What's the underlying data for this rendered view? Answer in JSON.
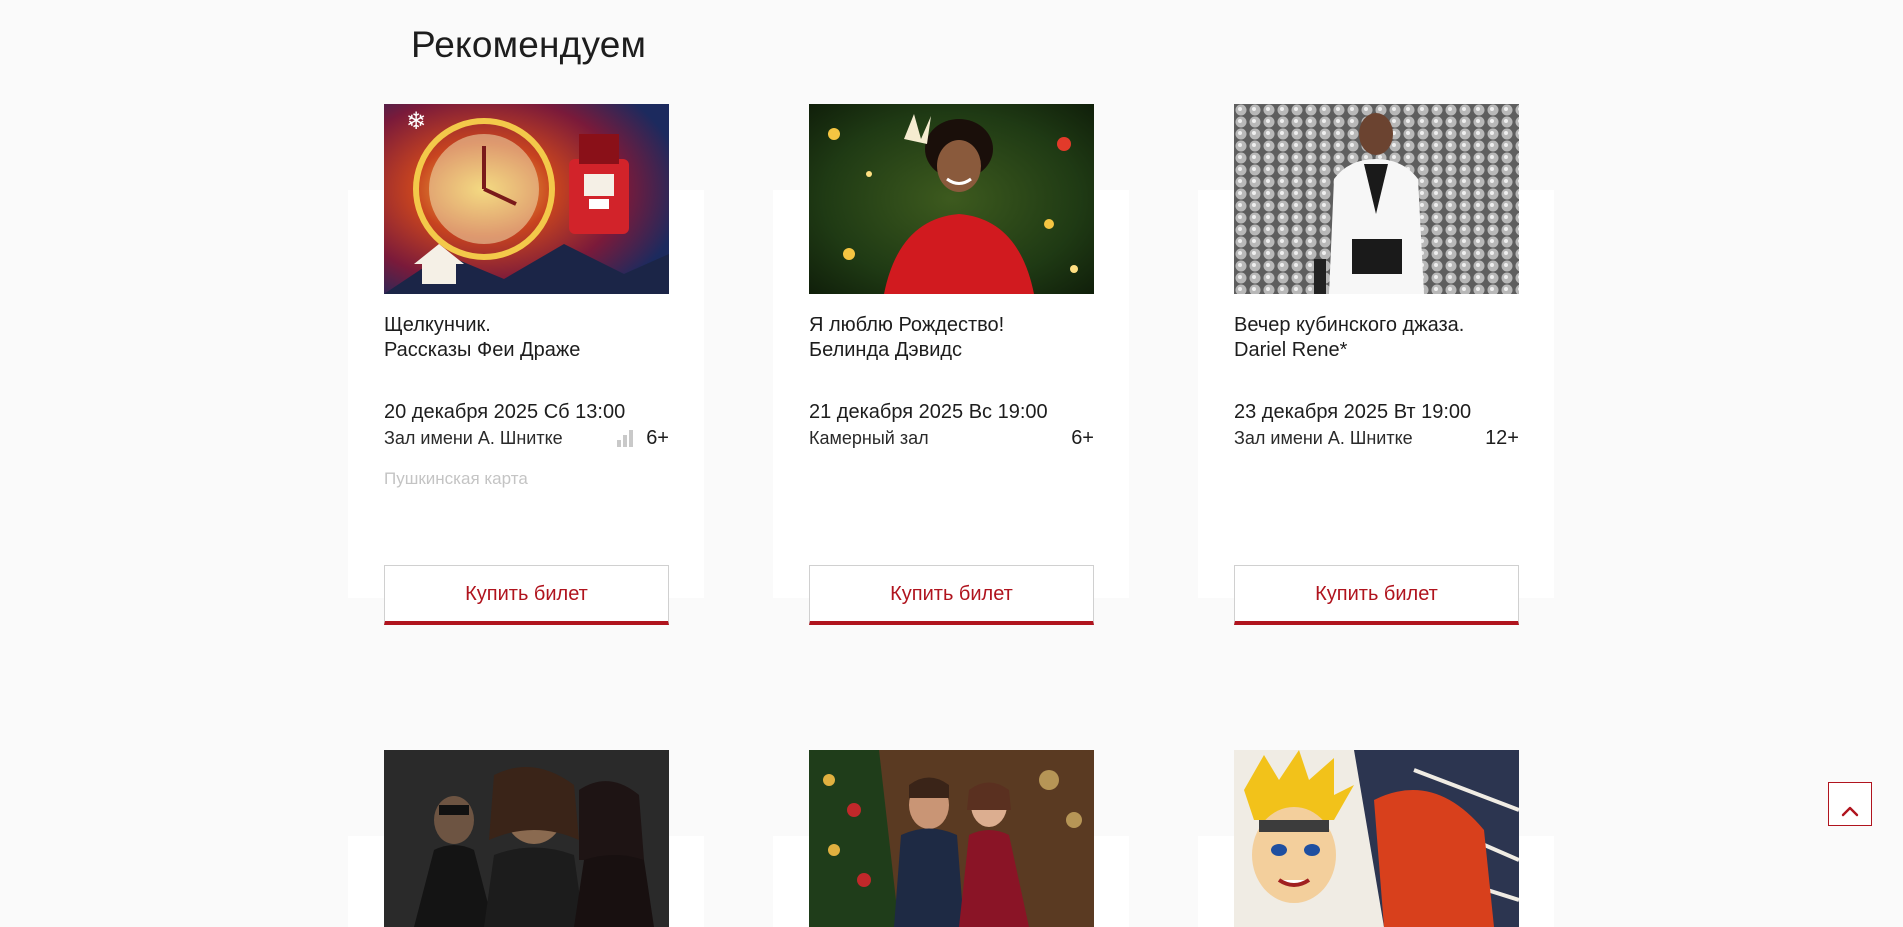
{
  "section": {
    "title": "Рекомендуем"
  },
  "cards": [
    {
      "title_line1": "Щелкунчик.",
      "title_line2": "Рассказы Феи Драже",
      "datetime": "20 декабря 2025 Сб 13:00",
      "venue": "Зал имени А. Шнитке",
      "age": "6+",
      "pushkin": "Пушкинская карта",
      "buy_label": "Купить билет",
      "image_icon": "nutcracker-clock-image"
    },
    {
      "title_line1": "Я люблю Рождество!",
      "title_line2": "Белинда Дэвидс",
      "datetime": "21 декабря 2025 Вс 19:00",
      "venue": "Камерный зал",
      "age": "6+",
      "buy_label": "Купить билет",
      "image_icon": "singer-christmas-image"
    },
    {
      "title_line1": "Вечер кубинского джаза.",
      "title_line2": "Dariel Rene*",
      "datetime": "23 декабря 2025 Вт 19:00",
      "venue": "Зал имени А. Шнитке",
      "age": "12+",
      "buy_label": "Купить билет",
      "image_icon": "jazz-performer-image"
    }
  ],
  "icons": {
    "signal": "signal-bars-icon",
    "scroll_top": "chevron-up-icon"
  },
  "colors": {
    "accent": "#b0141e",
    "background": "#fafafa",
    "card": "#ffffff",
    "muted": "#c4c4c4"
  }
}
